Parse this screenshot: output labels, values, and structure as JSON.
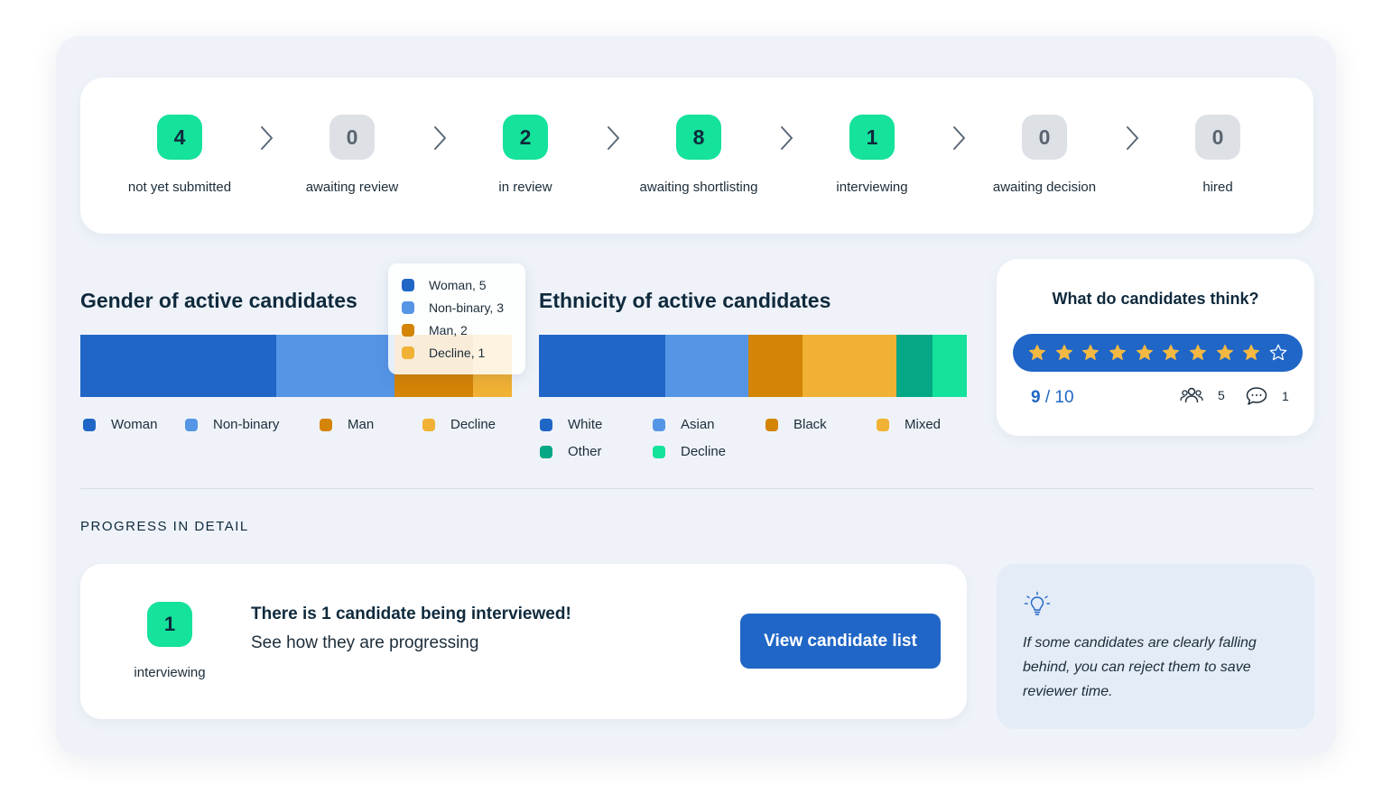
{
  "pipeline": {
    "stages": [
      {
        "count": "4",
        "label": "not yet submitted",
        "active": true
      },
      {
        "count": "0",
        "label": "awaiting review",
        "active": false
      },
      {
        "count": "2",
        "label": "in review",
        "active": true
      },
      {
        "count": "8",
        "label": "awaiting shortlisting",
        "active": true
      },
      {
        "count": "1",
        "label": "interviewing",
        "active": true
      },
      {
        "count": "0",
        "label": "awaiting decision",
        "active": false
      },
      {
        "count": "0",
        "label": "hired",
        "active": false
      }
    ]
  },
  "gender": {
    "title": "Gender of active candidates",
    "legend": [
      {
        "label": "Woman",
        "color": "#2066c6"
      },
      {
        "label": "Non-binary",
        "color": "#5595e6"
      },
      {
        "label": "Man",
        "color": "#d48406"
      },
      {
        "label": "Decline",
        "color": "#f0b134"
      }
    ],
    "tooltip": [
      "Woman, 5",
      "Non-binary, 3",
      "Man, 2",
      "Decline, 1"
    ]
  },
  "ethnicity": {
    "title": "Ethnicity of active candidates",
    "legend": [
      {
        "label": "White",
        "color": "#2066c6"
      },
      {
        "label": "Asian",
        "color": "#5595e6"
      },
      {
        "label": "Black",
        "color": "#d48406"
      },
      {
        "label": "Mixed",
        "color": "#f0b134"
      },
      {
        "label": "Other",
        "color": "#04a884"
      },
      {
        "label": "Decline",
        "color": "#15e29b"
      }
    ]
  },
  "chart_data": [
    {
      "type": "bar",
      "orientation": "horizontal-stacked",
      "title": "Gender of active candidates",
      "categories": [
        "Woman",
        "Non-binary",
        "Man",
        "Decline"
      ],
      "values": [
        5,
        3,
        2,
        1
      ],
      "colors": [
        "#2066c6",
        "#5595e6",
        "#d48406",
        "#f0b134"
      ]
    },
    {
      "type": "bar",
      "orientation": "horizontal-stacked",
      "title": "Ethnicity of active candidates",
      "categories": [
        "White",
        "Asian",
        "Black",
        "Mixed",
        "Other",
        "Decline"
      ],
      "values": [
        29.5,
        19.5,
        12.5,
        22,
        8.5,
        8
      ],
      "value_unit": "percent of bar (estimated)",
      "colors": [
        "#2066c6",
        "#5595e6",
        "#d48406",
        "#f0b134",
        "#04a884",
        "#15e29b"
      ]
    }
  ],
  "rating": {
    "question": "What do candidates think?",
    "stars_filled": 9,
    "stars_total": 10,
    "score": "9",
    "separator": "/",
    "max": "10",
    "respondents": "5",
    "comments": "1",
    "star_color": "#f5b942",
    "pill_color": "#2066c6"
  },
  "section": {
    "label": "PROGRESS IN DETAIL"
  },
  "progress": {
    "count": "1",
    "count_label": "interviewing",
    "headline": "There is 1 candidate being interviewed!",
    "subline": "See how they are progressing",
    "button": "View candidate list"
  },
  "tip": {
    "text": "If some candidates are clearly falling behind, you can reject them to save reviewer time."
  }
}
